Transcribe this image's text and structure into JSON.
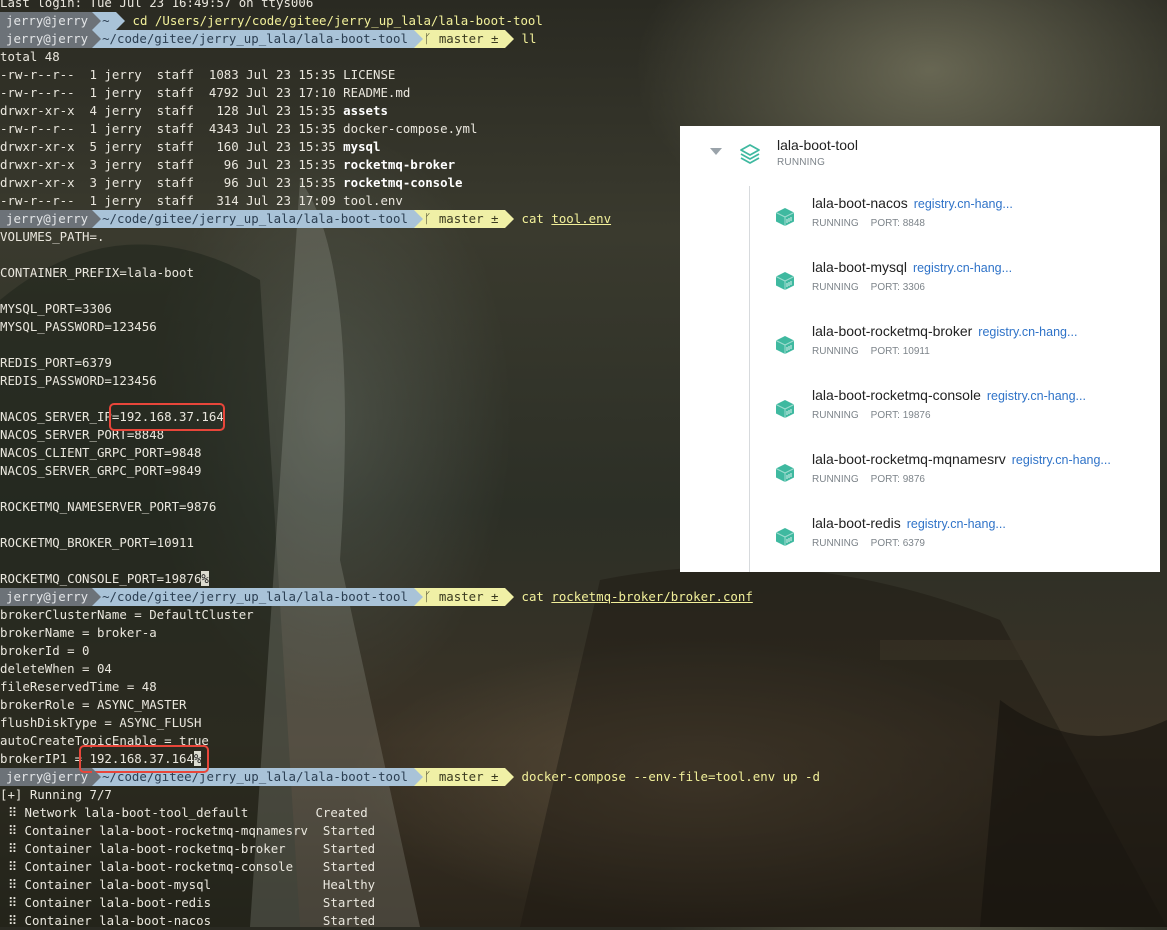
{
  "terminal": {
    "login": "Last login: Tue Jul 23 16:49:57 on ttys006",
    "user": "jerry@jerry",
    "branch": "master ±",
    "prompt1": {
      "path": "~",
      "cmd": "cd /Users/jerry/code/gitee/jerry_up_lala/lala-boot-tool"
    },
    "prompt2": {
      "path": "~/code/gitee/jerry_up_lala/lala-boot-tool",
      "cmd": "ll"
    },
    "ls_total": "total 48",
    "ls": [
      {
        "meta": "-rw-r--r--  1 jerry  staff  1083 Jul 23 15:35 ",
        "name": "LICENSE"
      },
      {
        "meta": "-rw-r--r--  1 jerry  staff  4792 Jul 23 17:10 ",
        "name": "README.md"
      },
      {
        "meta": "drwxr-xr-x  4 jerry  staff   128 Jul 23 15:35 ",
        "name": "assets"
      },
      {
        "meta": "-rw-r--r--  1 jerry  staff  4343 Jul 23 15:35 ",
        "name": "docker-compose.yml"
      },
      {
        "meta": "drwxr-xr-x  5 jerry  staff   160 Jul 23 15:35 ",
        "name": "mysql"
      },
      {
        "meta": "drwxr-xr-x  3 jerry  staff    96 Jul 23 15:35 ",
        "name": "rocketmq-broker"
      },
      {
        "meta": "drwxr-xr-x  3 jerry  staff    96 Jul 23 15:35 ",
        "name": "rocketmq-console"
      },
      {
        "meta": "-rw-r--r--  1 jerry  staff   314 Jul 23 17:09 ",
        "name": "tool.env"
      }
    ],
    "prompt3": {
      "path": "~/code/gitee/jerry_up_lala/lala-boot-tool",
      "cmd": "cat",
      "arg": "tool.env"
    },
    "env": [
      "VOLUMES_PATH=.",
      "",
      "CONTAINER_PREFIX=lala-boot",
      "",
      "MYSQL_PORT=3306",
      "MYSQL_PASSWORD=123456",
      "",
      "REDIS_PORT=6379",
      "REDIS_PASSWORD=123456",
      "",
      "NACOS_SERVER_IP=192.168.37.164",
      "NACOS_SERVER_PORT=8848",
      "NACOS_CLIENT_GRPC_PORT=9848",
      "NACOS_SERVER_GRPC_PORT=9849",
      "",
      "ROCKETMQ_NAMESERVER_PORT=9876",
      "",
      "ROCKETMQ_BROKER_PORT=10911",
      ""
    ],
    "env_last": "ROCKETMQ_CONSOLE_PORT=19876",
    "prompt4": {
      "path": "~/code/gitee/jerry_up_lala/lala-boot-tool",
      "cmd": "cat",
      "arg": "rocketmq-broker/broker.conf"
    },
    "conf": [
      "brokerClusterName = DefaultCluster",
      "brokerName = broker-a",
      "brokerId = 0",
      "deleteWhen = 04",
      "fileReservedTime = 48",
      "brokerRole = ASYNC_MASTER",
      "flushDiskType = ASYNC_FLUSH",
      "autoCreateTopicEnable = true"
    ],
    "conf_last": "brokerIP1 = 192.168.37.164",
    "prompt5": {
      "path": "~/code/gitee/jerry_up_lala/lala-boot-tool",
      "cmd": "docker-compose --env-file=tool.env up -d"
    },
    "compose_header": "[+] Running 7/7",
    "compose": [
      "⠿ Network lala-boot-tool_default         Created",
      "⠿ Container lala-boot-rocketmq-mqnamesrv  Started",
      "⠿ Container lala-boot-rocketmq-broker     Started",
      "⠿ Container lala-boot-rocketmq-console    Started",
      "⠿ Container lala-boot-mysql               Healthy",
      "⠿ Container lala-boot-redis               Started",
      "⠿ Container lala-boot-nacos               Started"
    ],
    "percent": "%"
  },
  "panel": {
    "project_name": "lala-boot-tool",
    "project_status": "RUNNING",
    "accent_color": "#3fb9a0",
    "services": [
      {
        "name": "lala-boot-nacos",
        "registry": "registry.cn-hang...",
        "status": "RUNNING",
        "port": "PORT: 8848"
      },
      {
        "name": "lala-boot-mysql",
        "registry": "registry.cn-hang...",
        "status": "RUNNING",
        "port": "PORT: 3306"
      },
      {
        "name": "lala-boot-rocketmq-broker",
        "registry": "registry.cn-hang...",
        "status": "RUNNING",
        "port": "PORT: 10911"
      },
      {
        "name": "lala-boot-rocketmq-console",
        "registry": "registry.cn-hang...",
        "status": "RUNNING",
        "port": "PORT: 19876"
      },
      {
        "name": "lala-boot-rocketmq-mqnamesrv",
        "registry": "registry.cn-hang...",
        "status": "RUNNING",
        "port": "PORT: 9876"
      },
      {
        "name": "lala-boot-redis",
        "registry": "registry.cn-hang...",
        "status": "RUNNING",
        "port": "PORT: 6379"
      }
    ]
  }
}
